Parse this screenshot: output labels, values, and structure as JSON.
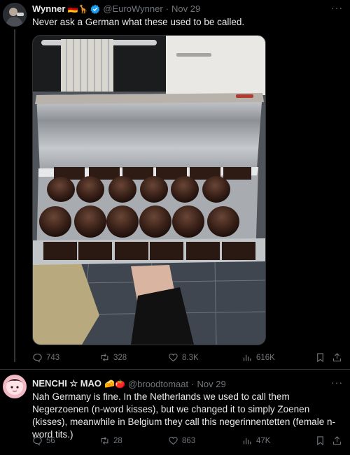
{
  "post1": {
    "display_name": "Wynner",
    "emoji": "🇩🇪🦒",
    "handle": "@EuroWynner",
    "sep": "·",
    "date": "Nov 29",
    "text": "Never ask a German what these used to be called.",
    "stats": {
      "replies": "743",
      "reposts": "328",
      "likes": "8.3K",
      "views": "616K"
    }
  },
  "post2": {
    "display_name": "NENCHI ☆ MAO",
    "emoji": "🧀🍅",
    "handle": "@broodtomaat",
    "sep": "·",
    "date": "Nov 29",
    "text": "Nah Germany is fine. In the Netherlands we used to call them Negerzoenen (n-word kisses), but we changed it to simply Zoenen (kisses), meanwhile in Belgium they call this negerinnentetten (female n-word tits.)",
    "stats": {
      "replies": "56",
      "reposts": "28",
      "likes": "863",
      "views": "47K"
    }
  },
  "more_icon": "···",
  "colors": {
    "background": "#000000",
    "text": "#e7e9ea",
    "muted": "#71767b",
    "verified": "#1d9bf0",
    "divider": "#2f3336"
  }
}
